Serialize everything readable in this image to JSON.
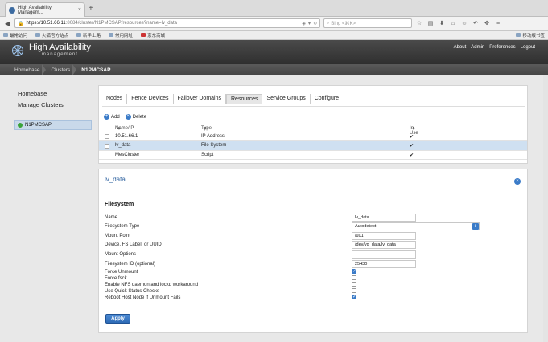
{
  "browser": {
    "tab_title": "High Availability Managem...",
    "tab_close": "×",
    "new_tab": "+",
    "url_host": "https://10.51.66.11",
    "url_rest": ":8084/cluster/N1PMCSAP/resources?name=lv_data",
    "search_placeholder": "Bing <⌘K>",
    "bookmarks": [
      "最常访问",
      "火狐官方站点",
      "新手上路",
      "常用网址",
      "京东商城"
    ],
    "bookmarks_right": "移动版书签"
  },
  "header": {
    "title": "High Availability",
    "subtitle": "management",
    "links": [
      "About",
      "Admin",
      "Preferences",
      "Logout"
    ]
  },
  "breadcrumb": [
    "Homebase",
    "Clusters",
    "N1PMCSAP"
  ],
  "sidebar": {
    "homebase": "Homebase",
    "manage": "Manage Clusters",
    "cluster": "N1PMCSAP"
  },
  "tabs": [
    "Nodes",
    "Fence Devices",
    "Failover Domains",
    "Resources",
    "Service Groups",
    "Configure"
  ],
  "actions": {
    "add": "Add",
    "delete": "Delete"
  },
  "table": {
    "headers": {
      "name": "Name/IP",
      "type": "Type",
      "inuse": "In Use"
    },
    "rows": [
      {
        "name": "10.51.66.1",
        "type": "IP Address",
        "inuse": "✔"
      },
      {
        "name": "lv_data",
        "type": "File System",
        "inuse": "✔"
      },
      {
        "name": "MesCluster",
        "type": "Script",
        "inuse": "✔"
      }
    ]
  },
  "detail": {
    "title": "lv_data",
    "section": "Filesystem",
    "fields": {
      "name_label": "Name",
      "name_value": "lv_data",
      "fstype_label": "Filesystem Type",
      "fstype_value": "Autodetect",
      "mount_label": "Mount Point",
      "mount_value": "/u01",
      "device_label": "Device, FS Label, or UUID",
      "device_value": "/dev/vg_data/lv_data",
      "options_label": "Mount Options",
      "options_value": "",
      "fsid_label": "Filesystem ID (optional)",
      "fsid_value": "25430",
      "force_unmount_label": "Force Unmount",
      "force_fsck_label": "Force fsck",
      "nfs_label": "Enable NFS daemon and lockd workaround",
      "quick_label": "Use Quick Status Checks",
      "reboot_label": "Reboot Host Node if Unmount Fails"
    },
    "checks": {
      "force_unmount": true,
      "force_fsck": false,
      "nfs": false,
      "quick": false,
      "reboot": true
    },
    "apply": "Apply"
  },
  "colors": {
    "accent": "#3a7bc8",
    "selected_row": "#cfe0f1",
    "header_bg": "#3a3a3a"
  }
}
